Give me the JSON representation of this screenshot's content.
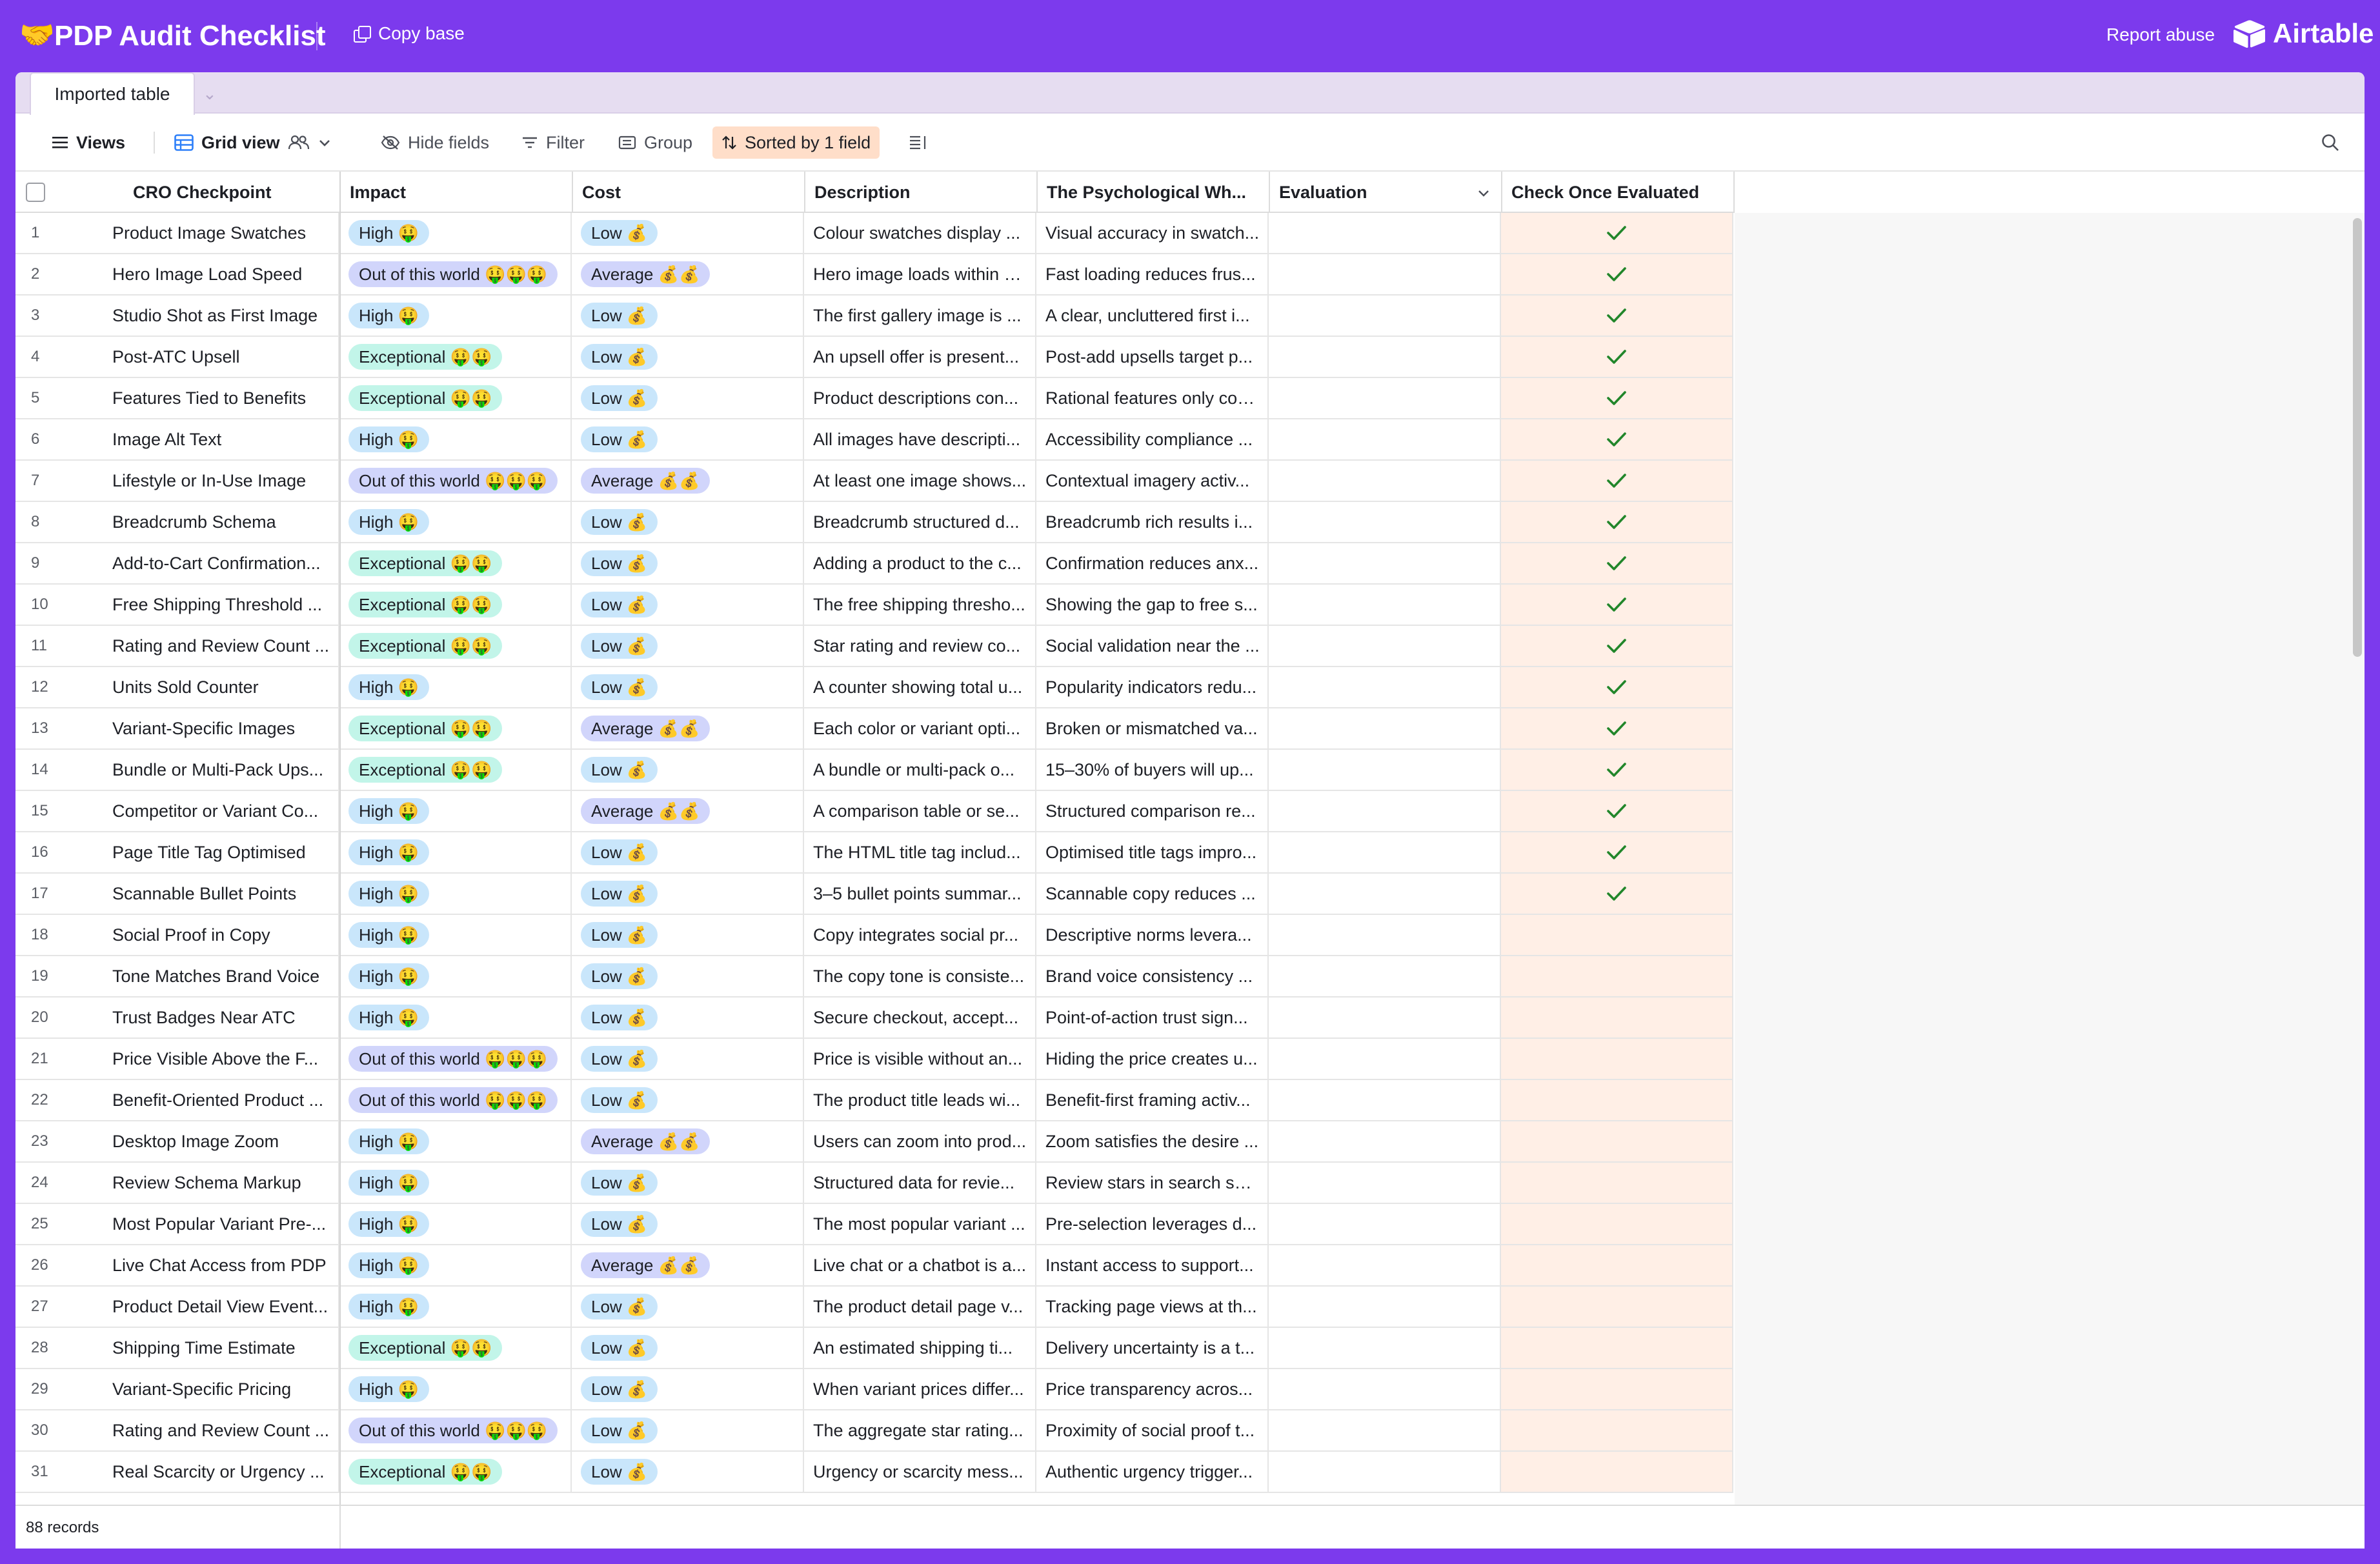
{
  "app": {
    "base_emoji": "🤝",
    "base_title": "PDP Audit Checklist",
    "copy_base": "Copy base",
    "report_abuse": "Report abuse",
    "brand": "Airtable"
  },
  "tabs": {
    "active": "Imported table"
  },
  "toolbar": {
    "views": "Views",
    "grid_view": "Grid view",
    "hide_fields": "Hide fields",
    "filter": "Filter",
    "group": "Group",
    "sorted": "Sorted by 1 field"
  },
  "columns": {
    "name": "CRO Checkpoint",
    "impact": "Impact",
    "cost": "Cost",
    "description": "Description",
    "psych": "The Psychological Wh...",
    "evaluation": "Evaluation",
    "check": "Check Once Evaluated"
  },
  "footer": {
    "records": "88 records"
  },
  "colors": {
    "brand_purple": "#7c3aed",
    "check_green": "#21862a",
    "check_col_bg": "#ffefe6",
    "sort_bg": "#ffdec9"
  },
  "rows": [
    {
      "num": "1",
      "name": "Product Image Swatches",
      "impact": "High 🤑",
      "cost": "Low 💰",
      "desc": "Colour swatches display ...",
      "psych": "Visual accuracy in swatch...",
      "checked": true
    },
    {
      "num": "2",
      "name": "Hero Image Load Speed",
      "impact": "Out of this world 🤑🤑🤑",
      "cost": "Average 💰💰",
      "desc": "Hero image loads within 2...",
      "psych": "Fast loading reduces frus...",
      "checked": true
    },
    {
      "num": "3",
      "name": "Studio Shot as First Image",
      "impact": "High 🤑",
      "cost": "Low 💰",
      "desc": "The first gallery image is ...",
      "psych": "A clear, uncluttered first i...",
      "checked": true
    },
    {
      "num": "4",
      "name": "Post-ATC Upsell",
      "impact": "Exceptional 🤑🤑",
      "cost": "Low 💰",
      "desc": "An upsell offer is present...",
      "psych": "Post-add upsells target p...",
      "checked": true
    },
    {
      "num": "5",
      "name": "Features Tied to Benefits",
      "impact": "Exceptional 🤑🤑",
      "cost": "Low 💰",
      "desc": "Product descriptions con...",
      "psych": "Rational features only con...",
      "checked": true
    },
    {
      "num": "6",
      "name": "Image Alt Text",
      "impact": "High 🤑",
      "cost": "Low 💰",
      "desc": "All images have descripti...",
      "psych": "Accessibility compliance ...",
      "checked": true
    },
    {
      "num": "7",
      "name": "Lifestyle or In-Use Image",
      "impact": "Out of this world 🤑🤑🤑",
      "cost": "Average 💰💰",
      "desc": "At least one image shows...",
      "psych": "Contextual imagery activ...",
      "checked": true
    },
    {
      "num": "8",
      "name": "Breadcrumb Schema",
      "impact": "High 🤑",
      "cost": "Low 💰",
      "desc": "Breadcrumb structured d...",
      "psych": "Breadcrumb rich results i...",
      "checked": true
    },
    {
      "num": "9",
      "name": "Add-to-Cart Confirmation...",
      "impact": "Exceptional 🤑🤑",
      "cost": "Low 💰",
      "desc": "Adding a product to the c...",
      "psych": "Confirmation reduces anx...",
      "checked": true
    },
    {
      "num": "10",
      "name": "Free Shipping Threshold ...",
      "impact": "Exceptional 🤑🤑",
      "cost": "Low 💰",
      "desc": "The free shipping thresho...",
      "psych": "Showing the gap to free s...",
      "checked": true
    },
    {
      "num": "11",
      "name": "Rating and Review Count ...",
      "impact": "Exceptional 🤑🤑",
      "cost": "Low 💰",
      "desc": "Star rating and review co...",
      "psych": "Social validation near the ...",
      "checked": true
    },
    {
      "num": "12",
      "name": "Units Sold Counter",
      "impact": "High 🤑",
      "cost": "Low 💰",
      "desc": "A counter showing total u...",
      "psych": "Popularity indicators redu...",
      "checked": true
    },
    {
      "num": "13",
      "name": "Variant-Specific Images",
      "impact": "Exceptional 🤑🤑",
      "cost": "Average 💰💰",
      "desc": "Each color or variant opti...",
      "psych": "Broken or mismatched va...",
      "checked": true
    },
    {
      "num": "14",
      "name": "Bundle or Multi-Pack Ups...",
      "impact": "Exceptional 🤑🤑",
      "cost": "Low 💰",
      "desc": "A bundle or multi-pack o...",
      "psych": "15–30% of buyers will up...",
      "checked": true
    },
    {
      "num": "15",
      "name": "Competitor or Variant Co...",
      "impact": "High 🤑",
      "cost": "Average 💰💰",
      "desc": "A comparison table or se...",
      "psych": "Structured comparison re...",
      "checked": true
    },
    {
      "num": "16",
      "name": "Page Title Tag Optimised",
      "impact": "High 🤑",
      "cost": "Low 💰",
      "desc": "The HTML title tag includ...",
      "psych": "Optimised title tags impro...",
      "checked": true
    },
    {
      "num": "17",
      "name": "Scannable Bullet Points",
      "impact": "High 🤑",
      "cost": "Low 💰",
      "desc": "3–5 bullet points summar...",
      "psych": "Scannable copy reduces ...",
      "checked": true
    },
    {
      "num": "18",
      "name": "Social Proof in Copy",
      "impact": "High 🤑",
      "cost": "Low 💰",
      "desc": "Copy integrates social pr...",
      "psych": "Descriptive norms levera...",
      "checked": false
    },
    {
      "num": "19",
      "name": "Tone Matches Brand Voice",
      "impact": "High 🤑",
      "cost": "Low 💰",
      "desc": "The copy tone is consiste...",
      "psych": "Brand voice consistency ...",
      "checked": false
    },
    {
      "num": "20",
      "name": "Trust Badges Near ATC",
      "impact": "High 🤑",
      "cost": "Low 💰",
      "desc": "Secure checkout, accept...",
      "psych": "Point-of-action trust sign...",
      "checked": false
    },
    {
      "num": "21",
      "name": "Price Visible Above the F...",
      "impact": "Out of this world 🤑🤑🤑",
      "cost": "Low 💰",
      "desc": "Price is visible without an...",
      "psych": "Hiding the price creates u...",
      "checked": false
    },
    {
      "num": "22",
      "name": "Benefit-Oriented Product ...",
      "impact": "Out of this world 🤑🤑🤑",
      "cost": "Low 💰",
      "desc": "The product title leads wi...",
      "psych": "Benefit-first framing activ...",
      "checked": false
    },
    {
      "num": "23",
      "name": "Desktop Image Zoom",
      "impact": "High 🤑",
      "cost": "Average 💰💰",
      "desc": "Users can zoom into prod...",
      "psych": "Zoom satisfies the desire ...",
      "checked": false
    },
    {
      "num": "24",
      "name": "Review Schema Markup",
      "impact": "High 🤑",
      "cost": "Low 💰",
      "desc": "Structured data for revie...",
      "psych": "Review stars in search sni...",
      "checked": false
    },
    {
      "num": "25",
      "name": "Most Popular Variant Pre-...",
      "impact": "High 🤑",
      "cost": "Low 💰",
      "desc": "The most popular variant ...",
      "psych": "Pre-selection leverages d...",
      "checked": false
    },
    {
      "num": "26",
      "name": "Live Chat Access from PDP",
      "impact": "High 🤑",
      "cost": "Average 💰💰",
      "desc": "Live chat or a chatbot is a...",
      "psych": "Instant access to support...",
      "checked": false
    },
    {
      "num": "27",
      "name": "Product Detail View Event...",
      "impact": "High 🤑",
      "cost": "Low 💰",
      "desc": "The product detail page v...",
      "psych": "Tracking page views at th...",
      "checked": false
    },
    {
      "num": "28",
      "name": "Shipping Time Estimate",
      "impact": "Exceptional 🤑🤑",
      "cost": "Low 💰",
      "desc": "An estimated shipping ti...",
      "psych": "Delivery uncertainty is a t...",
      "checked": false
    },
    {
      "num": "29",
      "name": "Variant-Specific Pricing",
      "impact": "High 🤑",
      "cost": "Low 💰",
      "desc": "When variant prices differ...",
      "psych": "Price transparency acros...",
      "checked": false
    },
    {
      "num": "30",
      "name": "Rating and Review Count ...",
      "impact": "Out of this world 🤑🤑🤑",
      "cost": "Low 💰",
      "desc": "The aggregate star rating...",
      "psych": "Proximity of social proof t...",
      "checked": false
    },
    {
      "num": "31",
      "name": "Real Scarcity or Urgency ...",
      "impact": "Exceptional 🤑🤑",
      "cost": "Low 💰",
      "desc": "Urgency or scarcity mess...",
      "psych": "Authentic urgency trigger...",
      "checked": false
    }
  ]
}
